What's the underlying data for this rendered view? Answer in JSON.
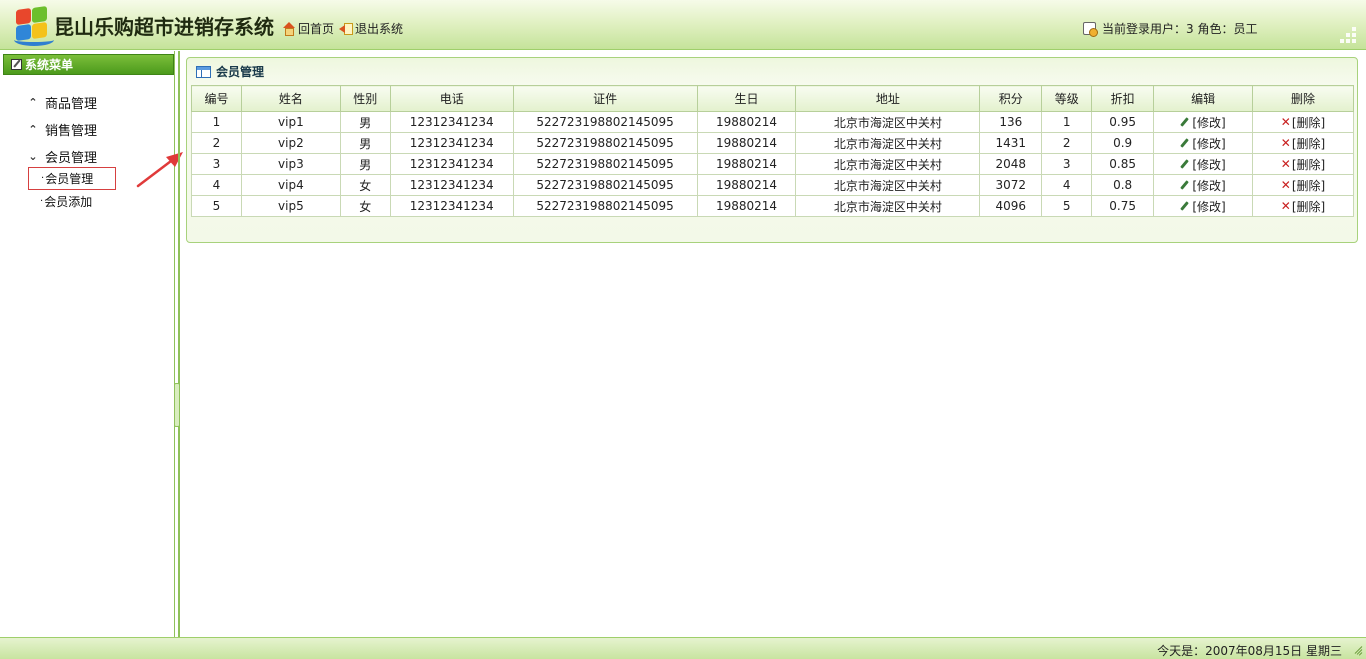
{
  "header": {
    "app_title": "昆山乐购超市进销存系统",
    "home_label": "回首页",
    "exit_label": "退出系统",
    "user_info": "当前登录用户：3 角色：员工"
  },
  "sidebar": {
    "title": "系统菜单",
    "menu": [
      {
        "label": "商品管理",
        "chevron": "⌃"
      },
      {
        "label": "销售管理",
        "chevron": "⌃"
      },
      {
        "label": "会员管理",
        "chevron": "⌄"
      }
    ],
    "submenu": [
      {
        "label": "会员管理",
        "active": true
      },
      {
        "label": "会员添加",
        "active": false
      }
    ]
  },
  "panel": {
    "title": "会员管理",
    "columns": [
      "编号",
      "姓名",
      "性别",
      "电话",
      "证件",
      "生日",
      "地址",
      "积分",
      "等级",
      "折扣",
      "编辑",
      "删除"
    ],
    "rows": [
      {
        "id": "1",
        "name": "vip1",
        "gender": "男",
        "phone": "12312341234",
        "idcard": "522723198802145095",
        "birthday": "19880214",
        "address": "北京市海淀区中关村",
        "points": "136",
        "level": "1",
        "discount": "0.95",
        "edit": "[修改]",
        "delete": "[删除]"
      },
      {
        "id": "2",
        "name": "vip2",
        "gender": "男",
        "phone": "12312341234",
        "idcard": "522723198802145095",
        "birthday": "19880214",
        "address": "北京市海淀区中关村",
        "points": "1431",
        "level": "2",
        "discount": "0.9",
        "edit": "[修改]",
        "delete": "[删除]"
      },
      {
        "id": "3",
        "name": "vip3",
        "gender": "男",
        "phone": "12312341234",
        "idcard": "522723198802145095",
        "birthday": "19880214",
        "address": "北京市海淀区中关村",
        "points": "2048",
        "level": "3",
        "discount": "0.85",
        "edit": "[修改]",
        "delete": "[删除]"
      },
      {
        "id": "4",
        "name": "vip4",
        "gender": "女",
        "phone": "12312341234",
        "idcard": "522723198802145095",
        "birthday": "19880214",
        "address": "北京市海淀区中关村",
        "points": "3072",
        "level": "4",
        "discount": "0.8",
        "edit": "[修改]",
        "delete": "[删除]"
      },
      {
        "id": "5",
        "name": "vip5",
        "gender": "女",
        "phone": "12312341234",
        "idcard": "522723198802145095",
        "birthday": "19880214",
        "address": "北京市海淀区中关村",
        "points": "4096",
        "level": "5",
        "discount": "0.75",
        "edit": "[修改]",
        "delete": "[删除]"
      }
    ]
  },
  "footer": {
    "date_text": "今天是：2007年08月15日 星期三"
  },
  "colors": {
    "accent_green": "#4c9a1c",
    "annotation_red": "#e03a3a",
    "delete_red": "#c81e1e"
  }
}
